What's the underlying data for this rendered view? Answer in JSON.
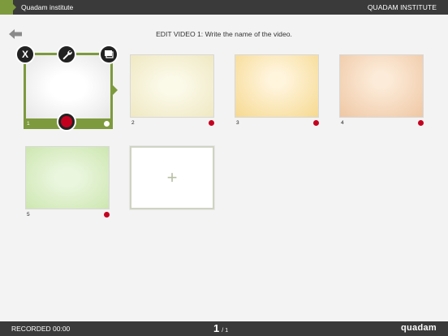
{
  "header": {
    "title": "Quadam institute",
    "org": "QUADAM INSTITUTE"
  },
  "instructions": "EDIT VIDEO 1: Write the name of the video.",
  "toolbar": {
    "close_label": "X"
  },
  "clips": [
    {
      "number": "1",
      "selected": true,
      "color": "#e9e9e9"
    },
    {
      "number": "2",
      "selected": false,
      "color": "#f6f1d3"
    },
    {
      "number": "3",
      "selected": false,
      "color": "#f9e6b3"
    },
    {
      "number": "4",
      "selected": false,
      "color": "#f5d9c0"
    },
    {
      "number": "5",
      "selected": false,
      "color": "#dcefc8"
    }
  ],
  "add_label": "+",
  "footer": {
    "recorded": "RECORDED 00:00",
    "page": "1",
    "sep": "/",
    "total": "1",
    "brand": "quadam"
  },
  "colors": {
    "accent": "#7d9a3d",
    "record": "#c4001f",
    "bar": "#3a3a3a"
  },
  "icons": [
    "back-arrow-icon",
    "close-icon",
    "wrench-icon",
    "slides-icon",
    "record-icon",
    "plus-icon"
  ]
}
